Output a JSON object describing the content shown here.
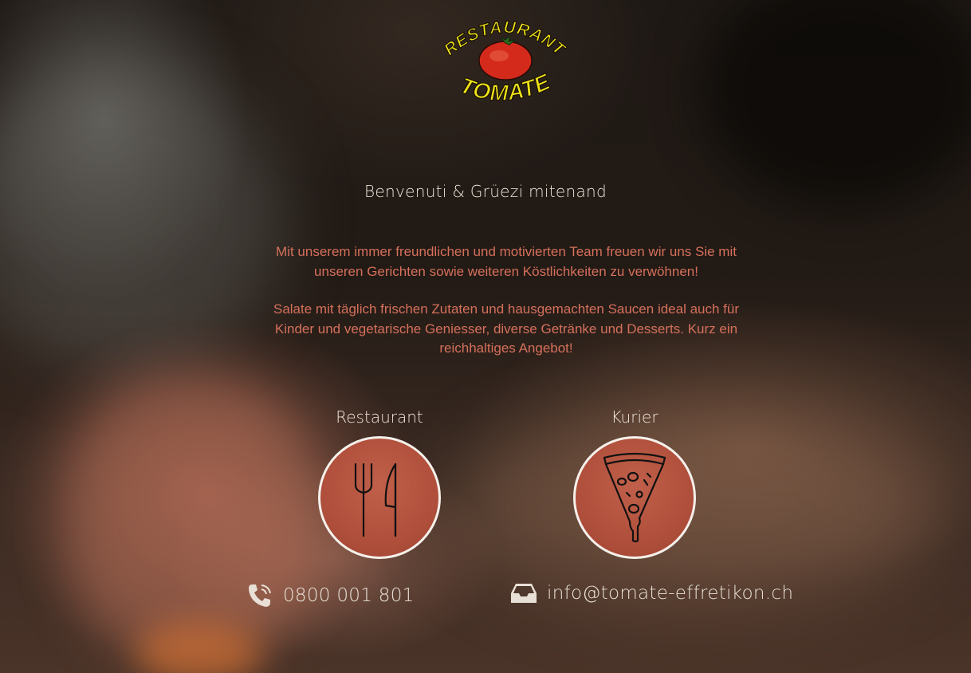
{
  "brand": {
    "line1": "RESTAURANT",
    "line2": "TOMATE"
  },
  "welcome": "Benvenuti & Grüezi mitenand",
  "intro": {
    "p1": "Mit unserem immer freundlichen und motivierten Team freuen wir uns Sie mit unseren Gerichten sowie weiteren Köstlichkeiten zu verwöhnen!",
    "p2": "Salate mit täglich frischen Zutaten und hausgemachten Saucen ideal auch für Kinder und vegetarische Geniesser, diverse Getränke und Desserts. Kurz ein reichhaltiges Angebot!"
  },
  "services": {
    "restaurant": {
      "label": "Restaurant",
      "icon": "fork-knife-icon"
    },
    "kurier": {
      "label": "Kurier",
      "icon": "pizza-slice-icon"
    }
  },
  "contact": {
    "phone": "0800 001 801",
    "email": "info@tomate-effretikon.ch"
  },
  "colors": {
    "accent_text": "#d5705b",
    "circle_fill": "#b0503c",
    "logo_yellow": "#f2e51a",
    "tomato_red": "#d42a1c"
  }
}
